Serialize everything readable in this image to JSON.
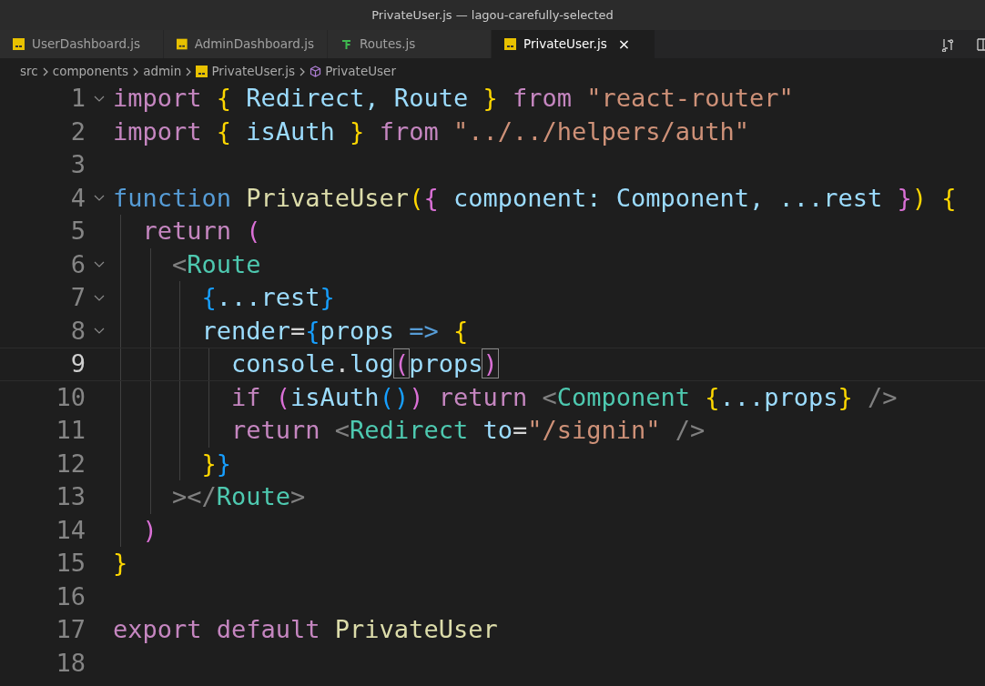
{
  "window": {
    "title": "PrivateUser.js — lagou-carefully-selected"
  },
  "tabs": [
    {
      "label": "UserDashboard.js",
      "kind": "js",
      "selected": false
    },
    {
      "label": "AdminDashboard.js",
      "kind": "js",
      "selected": false
    },
    {
      "label": "Routes.js",
      "kind": "routes",
      "selected": false
    },
    {
      "label": "PrivateUser.js",
      "kind": "js",
      "selected": true,
      "close": "×"
    }
  ],
  "breadcrumb": [
    {
      "label": "src",
      "kind": "folder"
    },
    {
      "label": "components",
      "kind": "folder"
    },
    {
      "label": "admin",
      "kind": "folder"
    },
    {
      "label": "PrivateUser.js",
      "kind": "js"
    },
    {
      "label": "PrivateUser",
      "kind": "symbol"
    }
  ],
  "lines": [
    {
      "number": "1",
      "foldable": true,
      "current": false,
      "tokens": [
        {
          "t": "import ",
          "kind": "kw"
        },
        {
          "t": "{",
          "kind": "b1"
        },
        {
          "t": " Redirect, Route ",
          "kind": "var"
        },
        {
          "t": "}",
          "kind": "b1"
        },
        {
          "t": " from ",
          "kind": "kw"
        },
        {
          "t": "\"react-router\"",
          "kind": "str"
        }
      ]
    },
    {
      "number": "2",
      "foldable": false,
      "current": false,
      "tokens": [
        {
          "t": "import ",
          "kind": "kw"
        },
        {
          "t": "{",
          "kind": "b1"
        },
        {
          "t": " isAuth ",
          "kind": "var"
        },
        {
          "t": "}",
          "kind": "b1"
        },
        {
          "t": " from ",
          "kind": "kw"
        },
        {
          "t": "\"../../helpers/auth\"",
          "kind": "str"
        }
      ]
    },
    {
      "number": "3",
      "foldable": false,
      "current": false
    },
    {
      "number": "4",
      "foldable": true,
      "current": false,
      "tokens": [
        {
          "t": "function ",
          "kind": "storage"
        },
        {
          "t": "PrivateUser",
          "kind": "fn"
        },
        {
          "t": "(",
          "kind": "b1"
        },
        {
          "t": "{",
          "kind": "b2"
        },
        {
          "t": " component: Component, ...rest ",
          "kind": "var"
        },
        {
          "t": "}",
          "kind": "b2"
        },
        {
          "t": ")",
          "kind": "b1"
        },
        {
          "t": " {",
          "kind": "b1"
        }
      ]
    },
    {
      "number": "5",
      "foldable": false,
      "current": false,
      "tokens": [
        {
          "t": "  return ",
          "kind": "kw"
        },
        {
          "t": "(",
          "kind": "b2"
        }
      ]
    },
    {
      "number": "6",
      "foldable": true,
      "current": false,
      "tokens": [
        {
          "t": "    <",
          "kind": "punct"
        },
        {
          "t": "Route",
          "kind": "tag"
        }
      ]
    },
    {
      "number": "7",
      "foldable": true,
      "current": false,
      "tokens": [
        {
          "t": "      {",
          "kind": "b3"
        },
        {
          "t": "...rest",
          "kind": "var"
        },
        {
          "t": "}",
          "kind": "b3"
        }
      ]
    },
    {
      "number": "8",
      "foldable": true,
      "current": false,
      "tokens": [
        {
          "t": "      render",
          "kind": "var"
        },
        {
          "t": "=",
          "kind": "plain"
        },
        {
          "t": "{",
          "kind": "b3"
        },
        {
          "t": "props ",
          "kind": "var"
        },
        {
          "t": "=>",
          "kind": "storage"
        },
        {
          "t": " {",
          "kind": "b1"
        }
      ]
    },
    {
      "number": "9",
      "foldable": false,
      "current": true,
      "tokens": [
        {
          "t": "        console",
          "kind": "var"
        },
        {
          "t": ".",
          "kind": "plain"
        },
        {
          "t": "log",
          "kind": "var"
        },
        {
          "t": "(",
          "kind": "b2",
          "matched": true
        },
        {
          "t": "props",
          "kind": "var"
        },
        {
          "t": ")",
          "kind": "b2",
          "matched": true
        }
      ]
    },
    {
      "number": "10",
      "foldable": false,
      "current": false,
      "tokens": [
        {
          "t": "        if ",
          "kind": "kw"
        },
        {
          "t": "(",
          "kind": "b2"
        },
        {
          "t": "isAuth",
          "kind": "var"
        },
        {
          "t": "()",
          "kind": "b3"
        },
        {
          "t": ")",
          "kind": "b2"
        },
        {
          "t": " return ",
          "kind": "kw"
        },
        {
          "t": "<",
          "kind": "punct"
        },
        {
          "t": "Component ",
          "kind": "tag"
        },
        {
          "t": "{",
          "kind": "b1"
        },
        {
          "t": "...props",
          "kind": "var"
        },
        {
          "t": "}",
          "kind": "b1"
        },
        {
          "t": " />",
          "kind": "punct"
        }
      ]
    },
    {
      "number": "11",
      "foldable": false,
      "current": false,
      "tokens": [
        {
          "t": "        return ",
          "kind": "kw"
        },
        {
          "t": "<",
          "kind": "punct"
        },
        {
          "t": "Redirect ",
          "kind": "tag"
        },
        {
          "t": "to",
          "kind": "var"
        },
        {
          "t": "=",
          "kind": "plain"
        },
        {
          "t": "\"/signin\"",
          "kind": "str"
        },
        {
          "t": " />",
          "kind": "punct"
        }
      ]
    },
    {
      "number": "12",
      "foldable": false,
      "current": false,
      "tokens": [
        {
          "t": "      }",
          "kind": "b1"
        },
        {
          "t": "}",
          "kind": "b3"
        }
      ]
    },
    {
      "number": "13",
      "foldable": false,
      "current": false,
      "tokens": [
        {
          "t": "    ></",
          "kind": "punct"
        },
        {
          "t": "Route",
          "kind": "tag"
        },
        {
          "t": ">",
          "kind": "punct"
        }
      ]
    },
    {
      "number": "14",
      "foldable": false,
      "current": false,
      "tokens": [
        {
          "t": "  )",
          "kind": "b2"
        }
      ]
    },
    {
      "number": "15",
      "foldable": false,
      "current": false,
      "tokens": [
        {
          "t": "}",
          "kind": "b1"
        }
      ]
    },
    {
      "number": "16",
      "foldable": false,
      "current": false
    },
    {
      "number": "17",
      "foldable": false,
      "current": false,
      "tokens": [
        {
          "t": "export default ",
          "kind": "kw"
        },
        {
          "t": "PrivateUser",
          "kind": "fn"
        }
      ]
    },
    {
      "number": "18",
      "foldable": false,
      "current": false
    }
  ]
}
